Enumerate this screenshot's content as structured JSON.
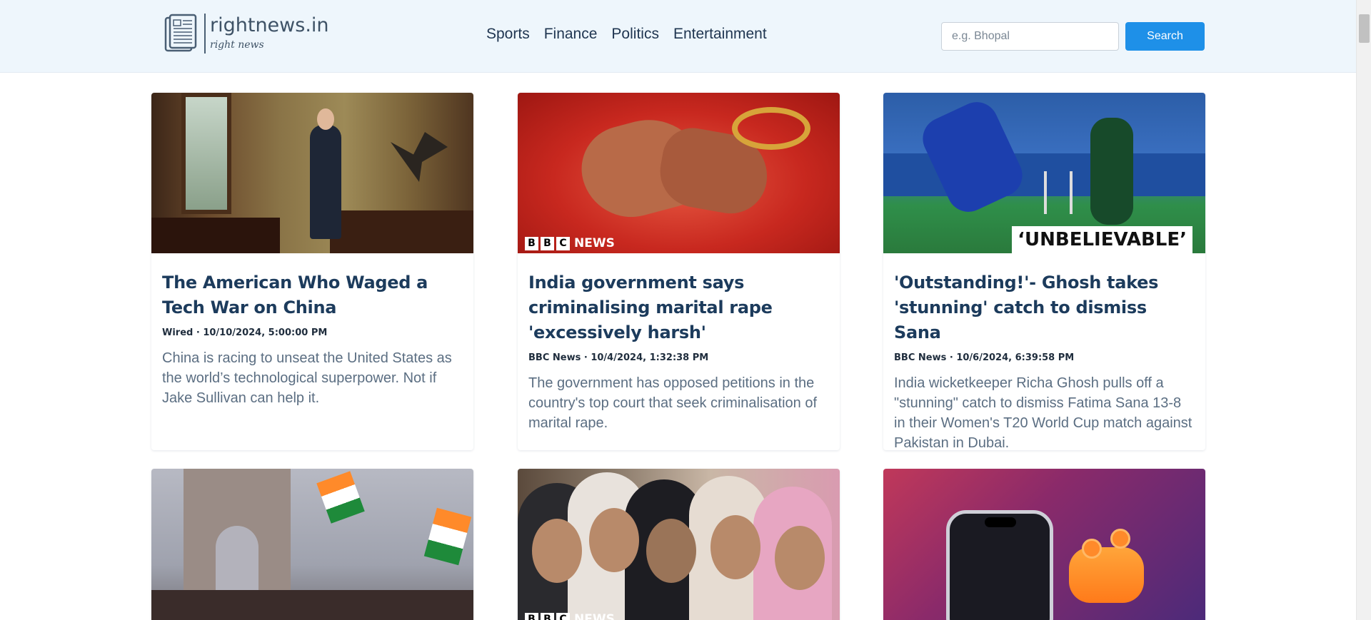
{
  "header": {
    "logo_title": "rightnews.in",
    "logo_sub": "right news",
    "nav": [
      "Sports",
      "Finance",
      "Politics",
      "Entertainment"
    ],
    "search_placeholder": "e.g. Bhopal",
    "search_label": "Search"
  },
  "articles": [
    {
      "title": "The American Who Waged a Tech War on China",
      "source": "Wired",
      "date": "10/10/2024, 5:00:00 PM",
      "description": "China is racing to unseat the United States as the world’s technological superpower. Not if Jake Sullivan can help it."
    },
    {
      "title": "India government says criminalising marital rape 'excessively harsh'",
      "source": "BBC News",
      "date": "10/4/2024, 1:32:38 PM",
      "description": "The government has opposed petitions in the country's top court that seek criminalisation of marital rape.",
      "image_logo": [
        "B",
        "B",
        "C",
        "NEWS"
      ]
    },
    {
      "title": "'Outstanding!'- Ghosh takes 'stunning' catch to dismiss Sana",
      "source": "BBC News",
      "date": "10/6/2024, 6:39:58 PM",
      "description": "India wicketkeeper Richa Ghosh pulls off a \"stunning\" catch to dismiss Fatima Sana 13-8 in their Women's T20 World Cup match against Pakistan in Dubai.",
      "image_caption": "‘UNBELIEVABLE’"
    },
    {},
    {
      "image_logo": [
        "B",
        "B",
        "C",
        "NEWS"
      ]
    },
    {}
  ],
  "colors": {
    "header_bg": "#eef6fc",
    "accent": "#1e90e8",
    "title": "#1c3b5c",
    "description": "#5b6e82"
  }
}
